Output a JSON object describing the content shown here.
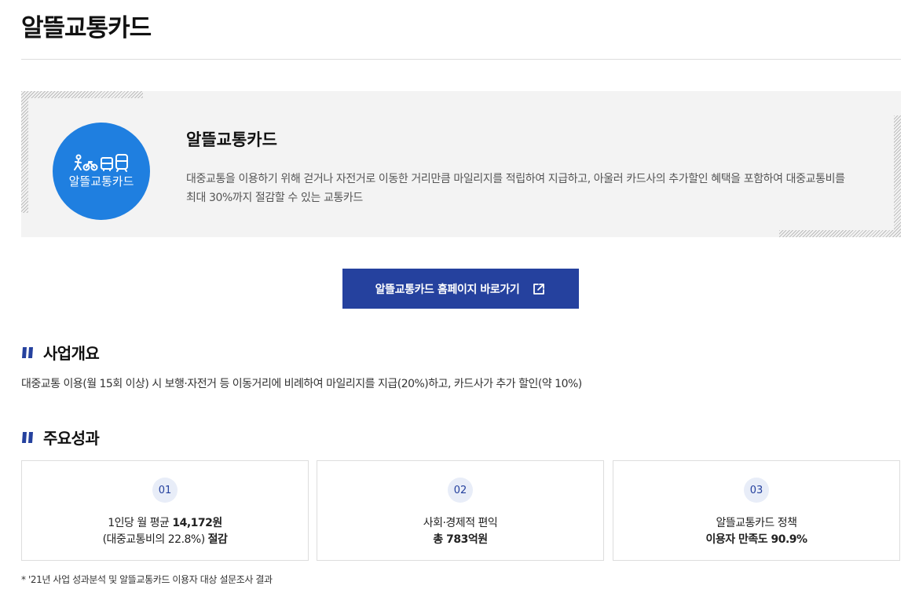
{
  "page": {
    "title": "알뜰교통카드"
  },
  "intro": {
    "logo_text": "알뜰교통카드",
    "title": "알뜰교통카드",
    "description": "대중교통을 이용하기 위해 걷거나 자전거로 이동한 거리만큼 마일리지를 적립하여 지급하고, 아울러 카드사의 추가할인 혜택을 포함하여 대중교통비를 최대 30%까지 절감할 수 있는 교통카드",
    "logo_color": "#1f7fe0"
  },
  "cta": {
    "label": "알뜰교통카드 홈페이지 바로가기",
    "icon": "external-link-icon",
    "color": "#25419e"
  },
  "overview": {
    "heading": "사업개요",
    "text": "대중교통 이용(월 15회 이상) 시 보행·자전거 등 이동거리에 비례하여 마일리지를 지급(20%)하고, 카드사가 추가 할인(약 10%)"
  },
  "results": {
    "heading": "주요성과",
    "cards": [
      {
        "num": "01",
        "line1_prefix": "1인당 월 평균 ",
        "line1_bold": "14,172원",
        "line2_prefix": "(대중교통비의 22.8%) ",
        "line2_bold": "절감"
      },
      {
        "num": "02",
        "line1": "사회·경제적 편익",
        "line2": "총 783억원"
      },
      {
        "num": "03",
        "line1": "알뜰교통카드 정책",
        "line2": "이용자 만족도 90.9%"
      }
    ]
  },
  "footnote": "* '21년 사업 성과분석 및 알뜰교통카드 이용자 대상 설문조사 결과"
}
